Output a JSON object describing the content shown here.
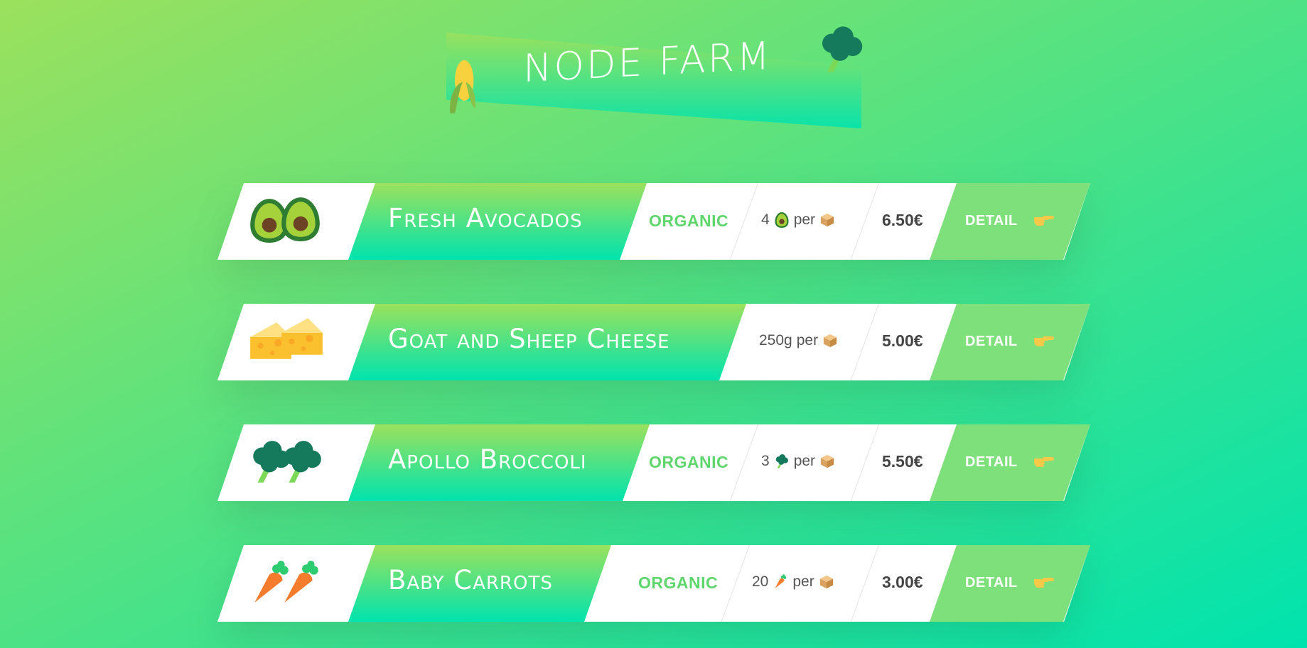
{
  "header": {
    "title": "Node Farm"
  },
  "products": [
    {
      "name": "Fresh Avocados",
      "organic_label": "ORGANIC",
      "quantity_number": "4",
      "per_label": "per",
      "price": "6.50€",
      "detail_label": "DETAIL",
      "emoji": "avocado-icon"
    },
    {
      "name": "Goat and Sheep Cheese",
      "organic_label": "",
      "quantity_number": "250g",
      "per_label": "per",
      "price": "5.00€",
      "detail_label": "DETAIL",
      "emoji": "cheese-icon"
    },
    {
      "name": "Apollo Broccoli",
      "organic_label": "ORGANIC",
      "quantity_number": "3",
      "per_label": "per",
      "price": "5.50€",
      "detail_label": "DETAIL",
      "emoji": "broccoli-icon"
    },
    {
      "name": "Baby Carrots",
      "organic_label": "ORGANIC",
      "quantity_number": "20",
      "per_label": "per",
      "price": "3.00€",
      "detail_label": "DETAIL",
      "emoji": "carrot-icon"
    }
  ],
  "colors": {
    "gradient_start": "#9be15d",
    "gradient_end": "#00e3ae",
    "organic": "#5fd66c",
    "detail_bg": "#7ee07a"
  }
}
